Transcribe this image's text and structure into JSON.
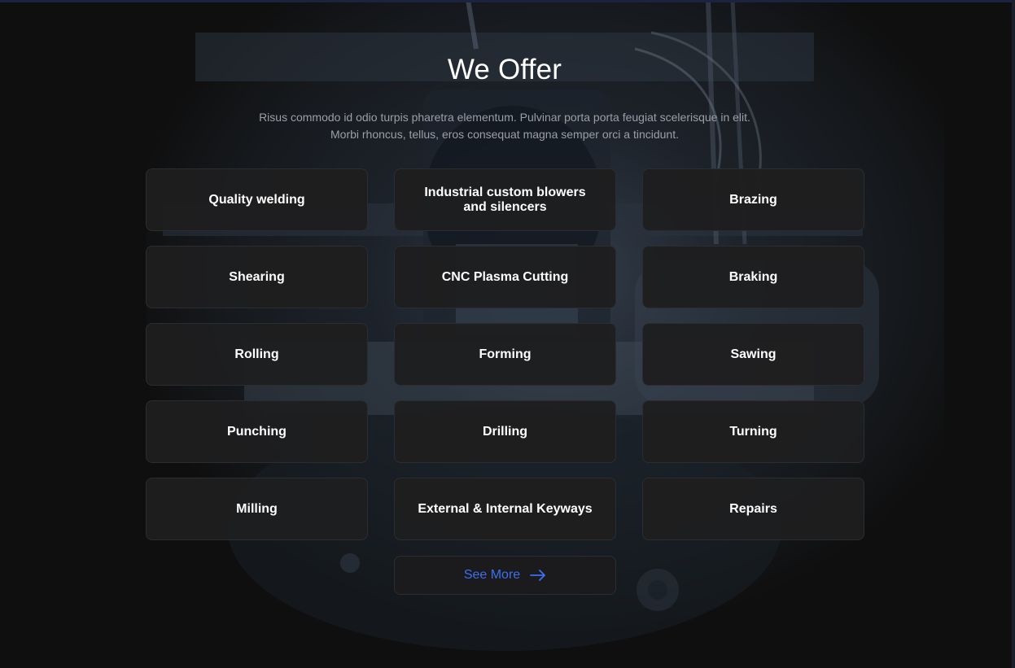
{
  "section": {
    "title": "We Offer",
    "subtitle": "Risus commodo id odio turpis pharetra elementum. Pulvinar porta porta feugiat scelerisque in elit. Morbi rhoncus, tellus, eros consequat magna semper orci a tincidunt."
  },
  "services": [
    {
      "label": "Quality welding"
    },
    {
      "label": "Industrial custom blowers and silencers"
    },
    {
      "label": "Brazing"
    },
    {
      "label": "Shearing"
    },
    {
      "label": "CNC Plasma Cutting"
    },
    {
      "label": "Braking"
    },
    {
      "label": "Rolling"
    },
    {
      "label": "Forming"
    },
    {
      "label": "Sawing"
    },
    {
      "label": "Punching"
    },
    {
      "label": "Drilling"
    },
    {
      "label": "Turning"
    },
    {
      "label": "Milling"
    },
    {
      "label": "External & Internal Keyways"
    },
    {
      "label": "Repairs"
    }
  ],
  "see_more": {
    "label": "See More",
    "icon": "arrow-right-icon",
    "color": "#3d6ff0"
  },
  "colors": {
    "background": "#0f0f0f",
    "card": "#1e1e1f",
    "card_border": "#2b2d31",
    "text": "#ffffff",
    "subtitle_text": "#9a9fa8",
    "accent": "#3d6ff0"
  }
}
